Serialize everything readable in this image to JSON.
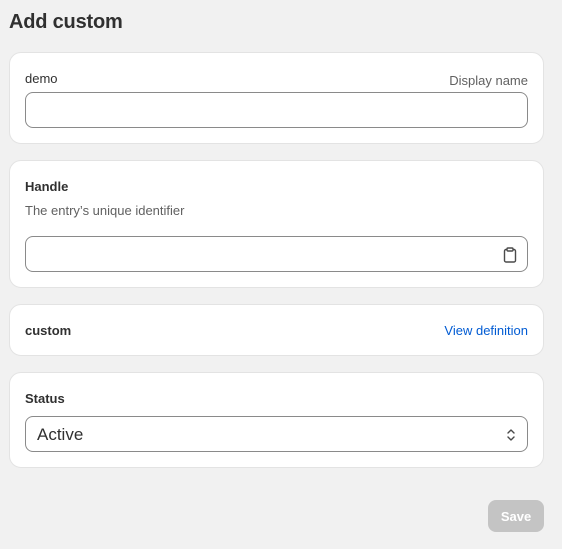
{
  "header": {
    "title": "Add custom"
  },
  "name_card": {
    "label": "demo",
    "hint": "Display name",
    "value": "",
    "placeholder": ""
  },
  "handle_card": {
    "title": "Handle",
    "description": "The entry’s unique identifier",
    "value": "",
    "placeholder": "",
    "copy_icon": "clipboard-icon"
  },
  "type_card": {
    "title": "custom",
    "link_label": "View definition"
  },
  "status_card": {
    "title": "Status",
    "selected": "Active",
    "chevron_icon": "select-chevron-icon"
  },
  "footer": {
    "save_label": "Save",
    "save_disabled": true
  },
  "colors": {
    "background": "#f1f1f1",
    "card": "#ffffff",
    "link": "#005bd3",
    "disabled_button": "#c4c4c4"
  }
}
